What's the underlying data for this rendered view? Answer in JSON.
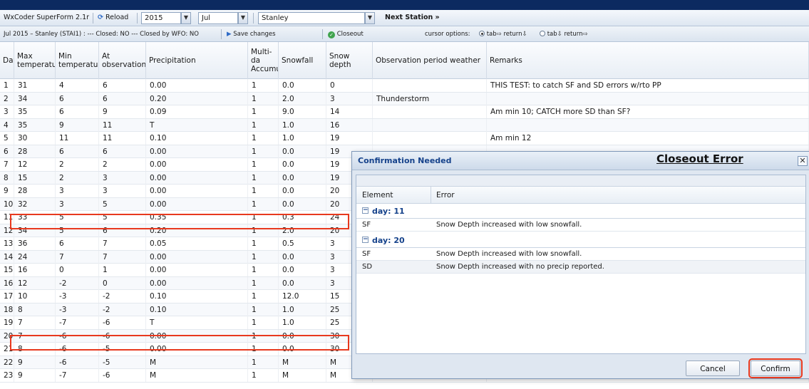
{
  "toolbar": {
    "app_name": "WxCoder SuperForm 2.1r",
    "reload_label": "Reload",
    "year": "2015",
    "month": "Jul",
    "station": "Stanley",
    "next_station_label": "Next Station »"
  },
  "toolbar2": {
    "status": "Jul 2015 – Stanley (STAI1) : --- Closed: NO --- Closed by WFO: NO",
    "save_label": "Save changes",
    "closeout_label": "Closeout",
    "cursor_label": "cursor options:",
    "opt1": "tab⇨ return⇩",
    "opt2": "tab⇩ return⇨"
  },
  "columns": {
    "day": "Day",
    "max": "Max temperatur",
    "min": "Min temperatur",
    "at": "At observation",
    "precip": "Precipitation",
    "multi": "Multi-da Accumu",
    "snowfall": "Snowfall",
    "snowdepth": "Snow depth",
    "weather": "Observation period weather",
    "remarks": "Remarks"
  },
  "rows": [
    {
      "day": "1",
      "max": "31",
      "min": "4",
      "at": "6",
      "precip": "0.00",
      "multi": "1",
      "snowfall": "0.0",
      "snowdepth": "0",
      "weather": "",
      "remarks": "THIS TEST: to catch SF and SD errors w/rto PP"
    },
    {
      "day": "2",
      "max": "34",
      "min": "6",
      "at": "6",
      "precip": "0.20",
      "multi": "1",
      "snowfall": "2.0",
      "snowdepth": "3",
      "weather": "Thunderstorm",
      "remarks": ""
    },
    {
      "day": "3",
      "max": "35",
      "min": "6",
      "at": "9",
      "precip": "0.09",
      "multi": "1",
      "snowfall": "9.0",
      "snowdepth": "14",
      "weather": "",
      "remarks": "Am min 10; CATCH more SD than SF?"
    },
    {
      "day": "4",
      "max": "35",
      "min": "9",
      "at": "11",
      "precip": "T",
      "multi": "1",
      "snowfall": "1.0",
      "snowdepth": "16",
      "weather": "",
      "remarks": ""
    },
    {
      "day": "5",
      "max": "30",
      "min": "11",
      "at": "11",
      "precip": "0.10",
      "multi": "1",
      "snowfall": "1.0",
      "snowdepth": "19",
      "weather": "",
      "remarks": "Am min 12"
    },
    {
      "day": "6",
      "max": "28",
      "min": "6",
      "at": "6",
      "precip": "0.00",
      "multi": "1",
      "snowfall": "0.0",
      "snowdepth": "19",
      "weather": "",
      "remarks": ""
    },
    {
      "day": "7",
      "max": "12",
      "min": "2",
      "at": "2",
      "precip": "0.00",
      "multi": "1",
      "snowfall": "0.0",
      "snowdepth": "19",
      "weather": "",
      "remarks": ""
    },
    {
      "day": "8",
      "max": "15",
      "min": "2",
      "at": "3",
      "precip": "0.00",
      "multi": "1",
      "snowfall": "0.0",
      "snowdepth": "19",
      "weather": "",
      "remarks": ""
    },
    {
      "day": "9",
      "max": "28",
      "min": "3",
      "at": "3",
      "precip": "0.00",
      "multi": "1",
      "snowfall": "0.0",
      "snowdepth": "20",
      "weather": "",
      "remarks": ""
    },
    {
      "day": "10",
      "max": "32",
      "min": "3",
      "at": "5",
      "precip": "0.00",
      "multi": "1",
      "snowfall": "0.0",
      "snowdepth": "20",
      "weather": "",
      "remarks": ""
    },
    {
      "day": "11",
      "max": "33",
      "min": "5",
      "at": "5",
      "precip": "0.35",
      "multi": "1",
      "snowfall": "0.3",
      "snowdepth": "24",
      "weather": "",
      "remarks": ""
    },
    {
      "day": "12",
      "max": "34",
      "min": "5",
      "at": "6",
      "precip": "0.20",
      "multi": "1",
      "snowfall": "2.0",
      "snowdepth": "20",
      "weather": "",
      "remarks": ""
    },
    {
      "day": "13",
      "max": "36",
      "min": "6",
      "at": "7",
      "precip": "0.05",
      "multi": "1",
      "snowfall": "0.5",
      "snowdepth": "3",
      "weather": "",
      "remarks": ""
    },
    {
      "day": "14",
      "max": "24",
      "min": "7",
      "at": "7",
      "precip": "0.00",
      "multi": "1",
      "snowfall": "0.0",
      "snowdepth": "3",
      "weather": "",
      "remarks": ""
    },
    {
      "day": "15",
      "max": "16",
      "min": "0",
      "at": "1",
      "precip": "0.00",
      "multi": "1",
      "snowfall": "0.0",
      "snowdepth": "3",
      "weather": "",
      "remarks": ""
    },
    {
      "day": "16",
      "max": "12",
      "min": "-2",
      "at": "0",
      "precip": "0.00",
      "multi": "1",
      "snowfall": "0.0",
      "snowdepth": "3",
      "weather": "",
      "remarks": ""
    },
    {
      "day": "17",
      "max": "10",
      "min": "-3",
      "at": "-2",
      "precip": "0.10",
      "multi": "1",
      "snowfall": "12.0",
      "snowdepth": "15",
      "weather": "",
      "remarks": ""
    },
    {
      "day": "18",
      "max": "8",
      "min": "-3",
      "at": "-2",
      "precip": "0.10",
      "multi": "1",
      "snowfall": "1.0",
      "snowdepth": "25",
      "weather": "",
      "remarks": ""
    },
    {
      "day": "19",
      "max": "7",
      "min": "-7",
      "at": "-6",
      "precip": "T",
      "multi": "1",
      "snowfall": "1.0",
      "snowdepth": "25",
      "weather": "",
      "remarks": ""
    },
    {
      "day": "20",
      "max": "7",
      "min": "-6",
      "at": "-6",
      "precip": "0.00",
      "multi": "1",
      "snowfall": "0.0",
      "snowdepth": "30",
      "weather": "",
      "remarks": ""
    },
    {
      "day": "21",
      "max": "8",
      "min": "-6",
      "at": "-5",
      "precip": "0.00",
      "multi": "1",
      "snowfall": "0.0",
      "snowdepth": "30",
      "weather": "",
      "remarks": ""
    },
    {
      "day": "22",
      "max": "9",
      "min": "-6",
      "at": "-5",
      "precip": "M",
      "multi": "1",
      "snowfall": "M",
      "snowdepth": "M",
      "weather": "",
      "remarks": ""
    },
    {
      "day": "23",
      "max": "9",
      "min": "-7",
      "at": "-6",
      "precip": "M",
      "multi": "1",
      "snowfall": "M",
      "snowdepth": "M",
      "weather": "",
      "remarks": ""
    }
  ],
  "highlighted_days": [
    "11",
    "20"
  ],
  "dialog": {
    "title": "Confirmation Needed",
    "heading": "Closeout Error",
    "col_element": "Element",
    "col_error": "Error",
    "groups": [
      {
        "label": "day: 11",
        "errors": [
          {
            "element": "SF",
            "error": "Snow Depth increased with low snowfall."
          }
        ]
      },
      {
        "label": "day: 20",
        "errors": [
          {
            "element": "SF",
            "error": "Snow Depth increased with low snowfall."
          },
          {
            "element": "SD",
            "error": "Snow Depth increased with no precip reported."
          }
        ]
      }
    ],
    "cancel_label": "Cancel",
    "confirm_label": "Confirm"
  },
  "colors": {
    "accent": "#15428b",
    "highlight": "#e8391e",
    "top_strip": "#0c2a60"
  }
}
